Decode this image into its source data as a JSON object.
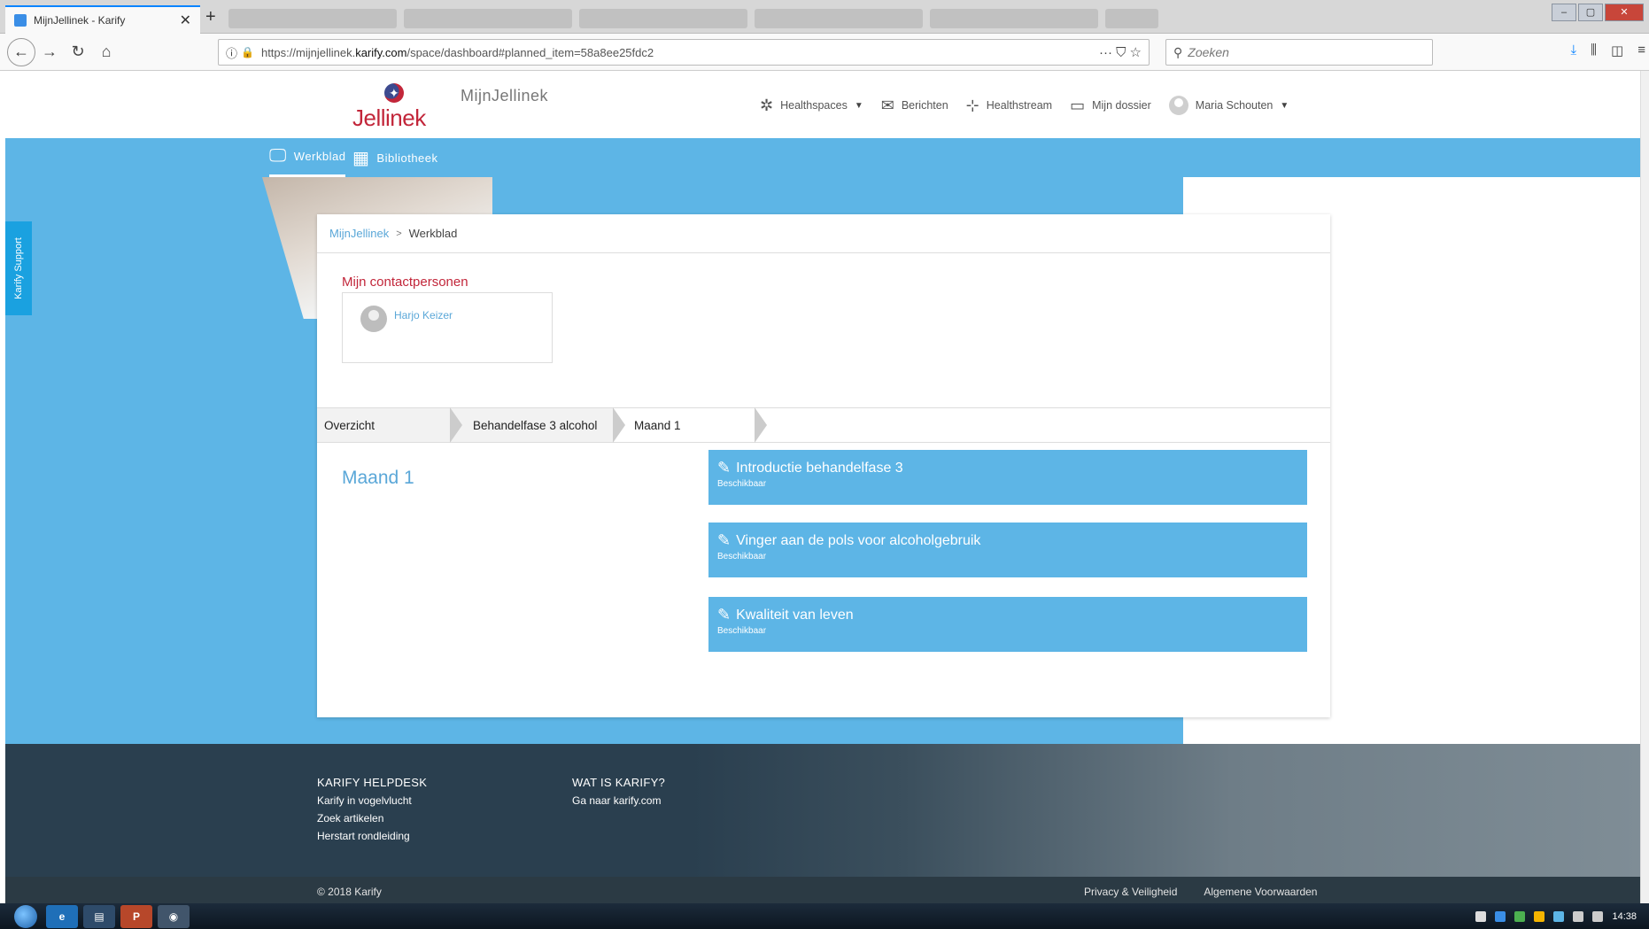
{
  "browser": {
    "tab_title": "MijnJellinek - Karify",
    "tab_close": "✕",
    "new_tab": "+",
    "url_prefix": "https://mijnjellinek.",
    "url_domain": "karify.com",
    "url_path": "/space/dashboard#planned_item=58a8ee25fdc2",
    "search_placeholder": "Zoeken",
    "url_actions": "··· ⛉ ☆"
  },
  "header": {
    "logo_text": "Jellinek",
    "site_name": "MijnJellinek",
    "nav": {
      "healthspaces": "Healthspaces",
      "berichten": "Berichten",
      "healthstream": "Healthstream",
      "mijn_dossier": "Mijn dossier",
      "user_name": "Maria Schouten"
    }
  },
  "subnav": {
    "werkblad": "Werkblad",
    "bibliotheek": "Bibliotheek"
  },
  "support_tab": "Karify Support",
  "breadcrumb": {
    "home": "MijnJellinek",
    "separator": ">",
    "current": "Werkblad"
  },
  "contacts": {
    "title": "Mijn contactpersonen",
    "items": [
      {
        "name": "Harjo Keizer"
      }
    ]
  },
  "steps": [
    "Overzicht",
    "Behandelfase 3 alcohol",
    "Maand 1"
  ],
  "month_title": "Maand 1",
  "tasks": [
    {
      "title": "Introductie behandelfase 3",
      "status": "Beschikbaar"
    },
    {
      "title": "Vinger aan de pols voor alcoholgebruik",
      "status": "Beschikbaar"
    },
    {
      "title": "Kwaliteit van leven",
      "status": "Beschikbaar"
    }
  ],
  "footer": {
    "helpdesk_title": "KARIFY HELPDESK",
    "helpdesk_links": [
      "Karify in vogelvlucht",
      "Zoek artikelen",
      "Herstart rondleiding"
    ],
    "what_title": "WAT IS KARIFY?",
    "what_links": [
      "Ga naar karify.com"
    ],
    "copyright": "© 2018 Karify",
    "privacy": "Privacy & Veiligheid",
    "terms": "Algemene Voorwaarden"
  },
  "taskbar": {
    "clock": "14:38"
  },
  "colors": {
    "accent_blue": "#5db5e6",
    "brand_red": "#c2263a",
    "link_blue": "#5aa7d8",
    "footer_dark": "#2a3f4f"
  }
}
